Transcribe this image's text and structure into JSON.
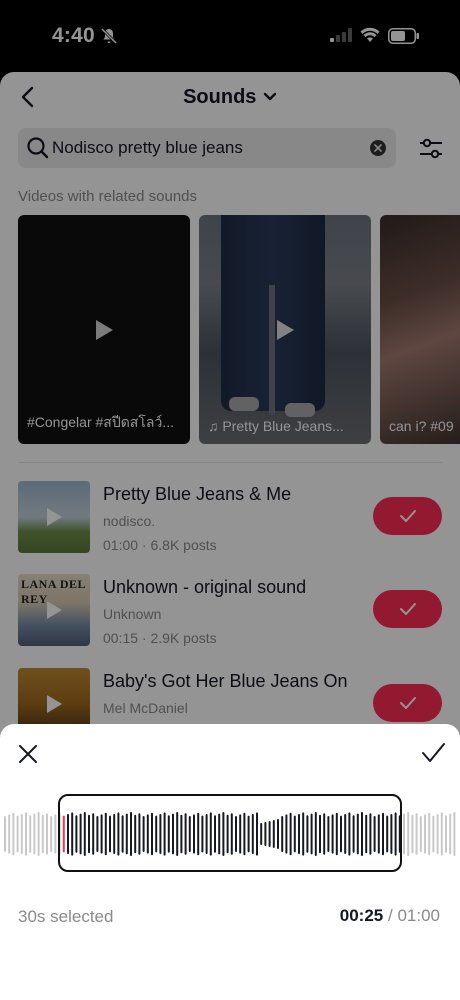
{
  "status_bar": {
    "time": "4:40"
  },
  "header": {
    "title": "Sounds"
  },
  "search": {
    "value": "Nodisco pretty blue jeans"
  },
  "related": {
    "label": "Videos with related sounds",
    "videos": [
      {
        "caption": "#Congelar #สปีดสโลว์..."
      },
      {
        "caption": "♫ Pretty Blue Jeans..."
      },
      {
        "caption": "can i? #09"
      }
    ]
  },
  "sounds": [
    {
      "title": "Pretty Blue Jeans & Me",
      "artist": "nodisco.",
      "meta": "01:00 · 6.8K posts"
    },
    {
      "title": "Unknown - original sound",
      "artist": "Unknown",
      "meta": "00:15 · 2.9K posts",
      "thumb_text": "LANA DEL REY"
    },
    {
      "title": "Baby's Got Her Blue Jeans On",
      "artist": "Mel McDaniel",
      "meta": ""
    }
  ],
  "trim_panel": {
    "selected_label": "30s selected",
    "current_time": "00:25",
    "separator": "/",
    "total_time": "01:00"
  },
  "colors": {
    "accent": "#fe2c55",
    "playhead": "#fe2c55"
  }
}
